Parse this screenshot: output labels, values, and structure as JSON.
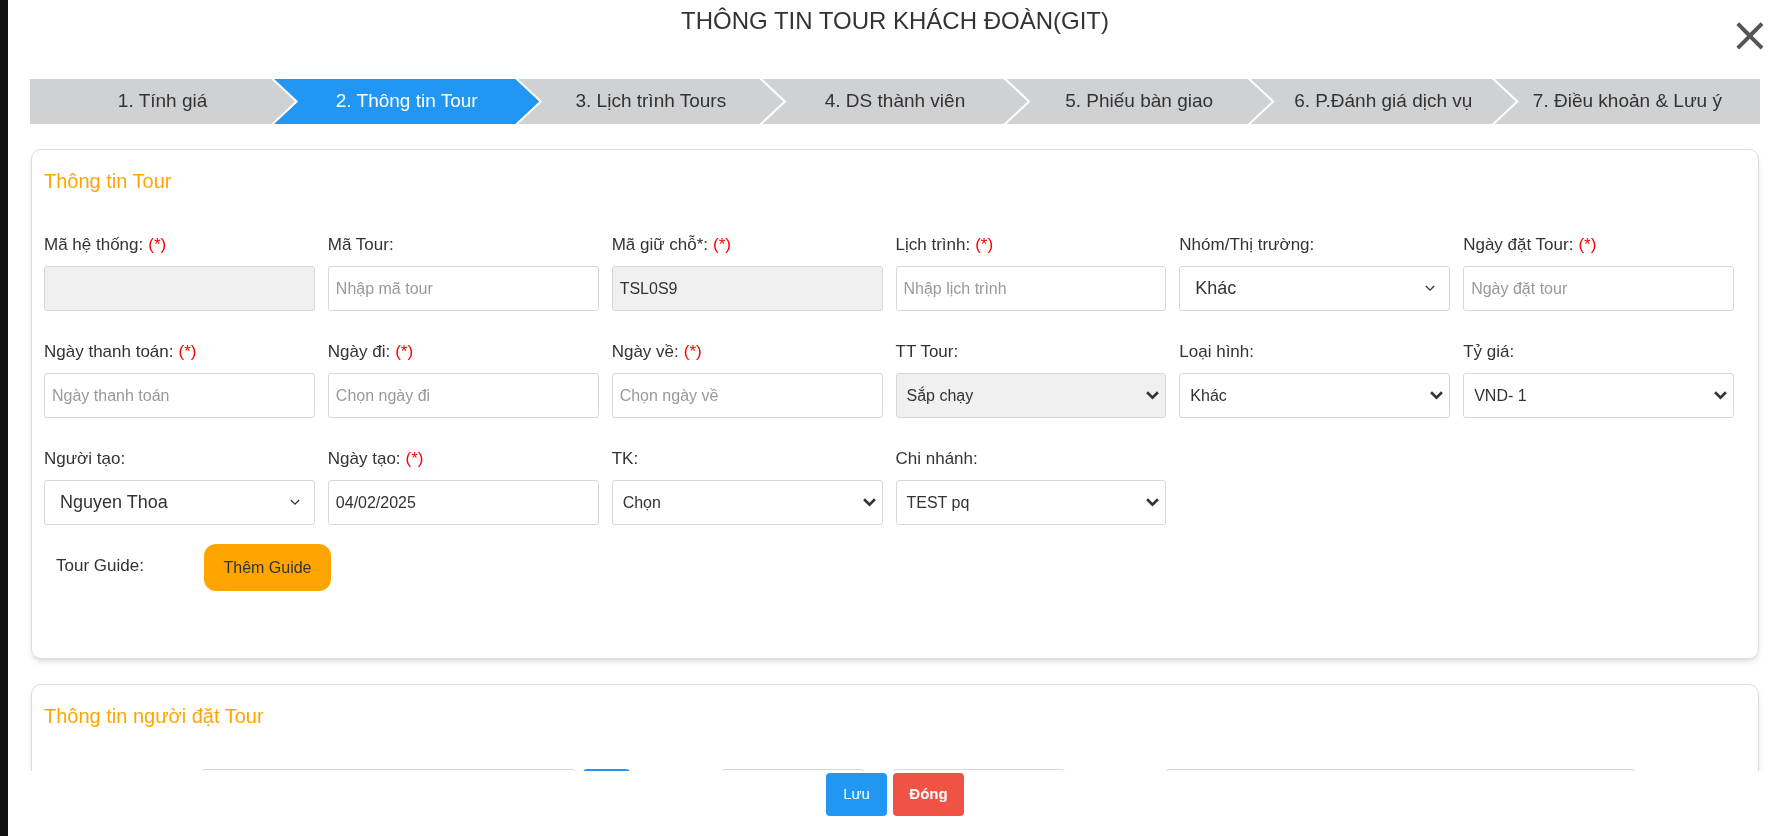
{
  "window": {
    "title": "THÔNG TIN TOUR KHÁCH ĐOÀN(GIT)",
    "close": "×"
  },
  "steps": [
    {
      "label": "1. Tính giá",
      "selected": false
    },
    {
      "label": "2. Thông tin Tour",
      "selected": true
    },
    {
      "label": "3. Lịch trình Tours",
      "selected": false
    },
    {
      "label": "4. DS thành viên",
      "selected": false
    },
    {
      "label": "5. Phiếu bàn giao",
      "selected": false
    },
    {
      "label": "6. P.Đánh giá dịch vụ",
      "selected": false
    },
    {
      "label": "7. Điều khoản & Lưu ý",
      "selected": false
    }
  ],
  "tour_info": {
    "title": "Thông tin Tour",
    "fields": [
      {
        "label": "Mã hệ thống:",
        "required": true,
        "kind": "input",
        "disabled": true
      },
      {
        "label": "Mã Tour:",
        "required": false,
        "kind": "input",
        "placeholder": "Nhập mã tour",
        "disabled": false
      },
      {
        "label": "Mã giữ chỗ*:",
        "required": true,
        "kind": "input",
        "value": "TSL0S9",
        "disabled": true
      },
      {
        "label": "Lịch trình:",
        "required": true,
        "kind": "input",
        "placeholder": "Nhập lịch trình",
        "disabled": false
      },
      {
        "label": "Nhóm/Thị trường:",
        "required": false,
        "kind": "combo",
        "value": "Khác",
        "disabled": false
      },
      {
        "label": "Ngày đặt Tour:",
        "required": true,
        "kind": "input",
        "placeholder": "Ngày đặt tour",
        "disabled": false
      },
      {
        "label": "Ngày thanh toán:",
        "required": true,
        "kind": "input",
        "placeholder": "Ngày thanh toán",
        "disabled": false
      },
      {
        "label": "Ngày đi:",
        "required": true,
        "kind": "input",
        "placeholder": "Chọn ngày đi",
        "disabled": false
      },
      {
        "label": "Ngày về:",
        "required": true,
        "kind": "input",
        "placeholder": "Chọn ngày về",
        "disabled": false
      },
      {
        "label": "TT Tour:",
        "required": false,
        "kind": "select",
        "value": "Sắp chạy",
        "disabled": true
      },
      {
        "label": "Loại hình:",
        "required": false,
        "kind": "select",
        "value": "Khác",
        "disabled": false
      },
      {
        "label": "Tỷ giá:",
        "required": false,
        "kind": "select",
        "value": "VND- 1",
        "disabled": false
      },
      {
        "label": "Người tạo:",
        "required": false,
        "kind": "combo",
        "value": "Nguyen Thoa",
        "disabled": false
      },
      {
        "label": "Ngày tạo:",
        "required": true,
        "kind": "input",
        "value": "04/02/2025",
        "disabled": false
      },
      {
        "label": "TK:",
        "required": false,
        "kind": "select",
        "value": "Chọn",
        "disabled": false
      },
      {
        "label": "Chi nhánh:",
        "required": false,
        "kind": "select",
        "value": "TEST pq",
        "disabled": false
      }
    ],
    "required_mark": "(*)",
    "guide_label": "Tour Guide:",
    "guide_button": "Thêm Guide"
  },
  "booker_info": {
    "title": "Thông tin người đặt Tour",
    "controls": [
      {
        "kind": "input"
      },
      {
        "kind": "button"
      },
      {
        "kind": "input"
      },
      {
        "kind": "input"
      },
      {
        "kind": "input"
      }
    ]
  },
  "footer": {
    "buttons": [
      {
        "label": "Lưu",
        "kind": "primary"
      },
      {
        "label": "Đóng",
        "kind": "danger"
      }
    ]
  }
}
